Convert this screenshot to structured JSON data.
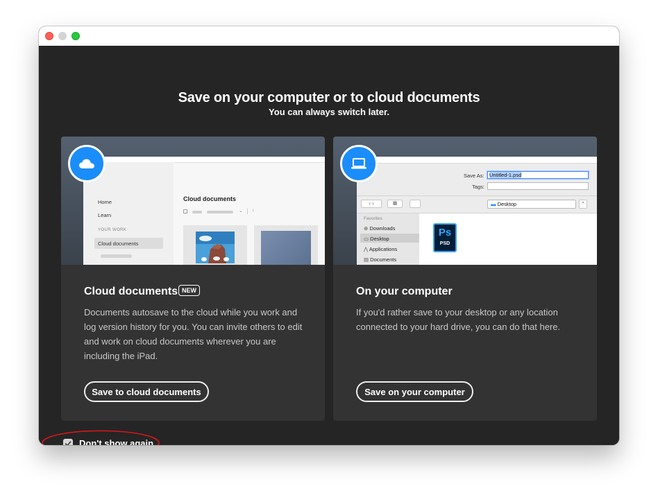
{
  "dialog": {
    "heading": "Save on your computer or to cloud documents",
    "subheading": "You can always switch later."
  },
  "cards": {
    "cloud": {
      "title": "Cloud documents",
      "badge": "NEW",
      "description": "Documents autosave to the cloud while you work and log version history for you. You can invite others to edit and work on cloud documents wherever you are including the iPad.",
      "button": "Save to cloud documents",
      "icon": "cloud-icon",
      "preview": {
        "nav": [
          "Home",
          "Learn"
        ],
        "section": "YOUR WORK",
        "selected": "Cloud documents",
        "main_title": "Cloud documents"
      }
    },
    "computer": {
      "title": "On your computer",
      "description": "If you'd rather save to your desktop or any location connected to your hard drive, you can do that here.",
      "button": "Save on your computer",
      "icon": "laptop-icon",
      "preview": {
        "save_as_label": "Save As:",
        "save_as_value": "Untitled-1.psd",
        "tags_label": "Tags:",
        "location": "Desktop",
        "favorites_label": "Favorites",
        "favorites": [
          "Downloads",
          "Desktop",
          "Applications",
          "Documents"
        ],
        "file_app": "Ps",
        "file_type": "PSD"
      }
    }
  },
  "footer": {
    "checkbox_label": "Don't show again",
    "checked": true
  },
  "colors": {
    "background": "#252525",
    "card": "#333333",
    "accent_blue": "#1b8dfa",
    "annotation": "#d9161c"
  }
}
